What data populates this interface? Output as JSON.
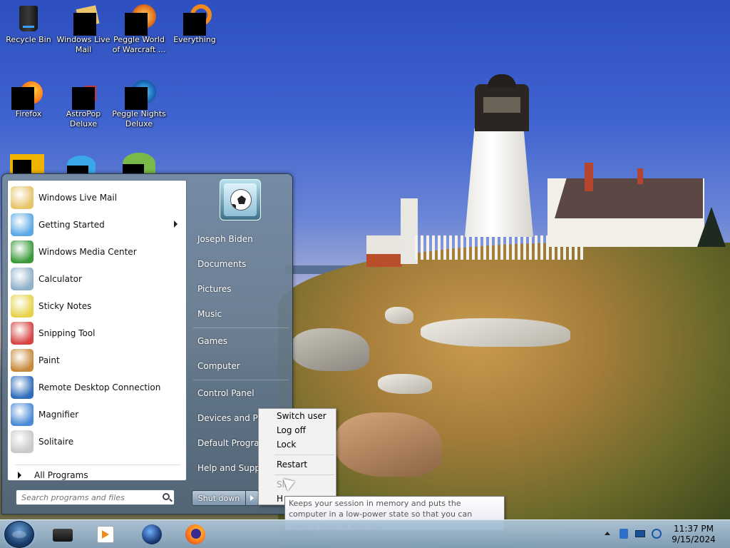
{
  "desktop": {
    "icons": [
      {
        "label": "Recycle Bin",
        "icon": "recycle-bin-icon"
      },
      {
        "label": "Windows Live Mail",
        "icon": "windows-live-mail-icon"
      },
      {
        "label": "Peggle World of Warcraft ...",
        "icon": "peggle-wow-icon"
      },
      {
        "label": "Everything",
        "icon": "everything-icon"
      },
      {
        "label": "Firefox",
        "icon": "firefox-icon"
      },
      {
        "label": "AstroPop Deluxe",
        "icon": "astropop-icon"
      },
      {
        "label": "Peggle Nights Deluxe",
        "icon": "peggle-nights-icon"
      }
    ]
  },
  "start_menu": {
    "programs": [
      {
        "label": "Windows Live Mail",
        "icon": "mail-icon"
      },
      {
        "label": "Getting Started",
        "icon": "getting-started-icon",
        "has_submenu": true
      },
      {
        "label": "Windows Media Center",
        "icon": "media-center-icon"
      },
      {
        "label": "Calculator",
        "icon": "calculator-icon"
      },
      {
        "label": "Sticky Notes",
        "icon": "sticky-notes-icon"
      },
      {
        "label": "Snipping Tool",
        "icon": "snipping-tool-icon"
      },
      {
        "label": "Paint",
        "icon": "paint-icon"
      },
      {
        "label": "Remote Desktop Connection",
        "icon": "remote-desktop-icon"
      },
      {
        "label": "Magnifier",
        "icon": "magnifier-icon"
      },
      {
        "label": "Solitaire",
        "icon": "solitaire-icon"
      }
    ],
    "all_programs": "All Programs",
    "search_placeholder": "Search programs and files",
    "user_name": "Joseph Biden",
    "right_links": [
      "Documents",
      "Pictures",
      "Music",
      "Games",
      "Computer",
      "Control Panel",
      "Devices and Printers",
      "Default Programs",
      "Help and Support"
    ],
    "shutdown_label": "Shut down"
  },
  "power_menu": {
    "items": [
      "Switch user",
      "Log off",
      "Lock",
      "Restart",
      "Sleep",
      "Hibernate"
    ],
    "sleep_visible": "Sle",
    "hibernate_visible": "H"
  },
  "tooltip": {
    "text": "Keeps your session in memory and puts the computer in a low-power state so that you can quickly resume working."
  },
  "taskbar": {
    "pinned": [
      "explorer-icon",
      "media-player-icon",
      "browser-icon",
      "firefox-icon"
    ],
    "tray": [
      "show-hidden-icons-arrow",
      "tray-app-icon",
      "network-icon",
      "action-center-icon"
    ],
    "time": "11:37 PM",
    "date": "9/15/2024"
  },
  "colors": {
    "start_menu_bg": "#6b8399",
    "taskbar_bg": "#a3bfd6",
    "tooltip_text": "#575757"
  }
}
